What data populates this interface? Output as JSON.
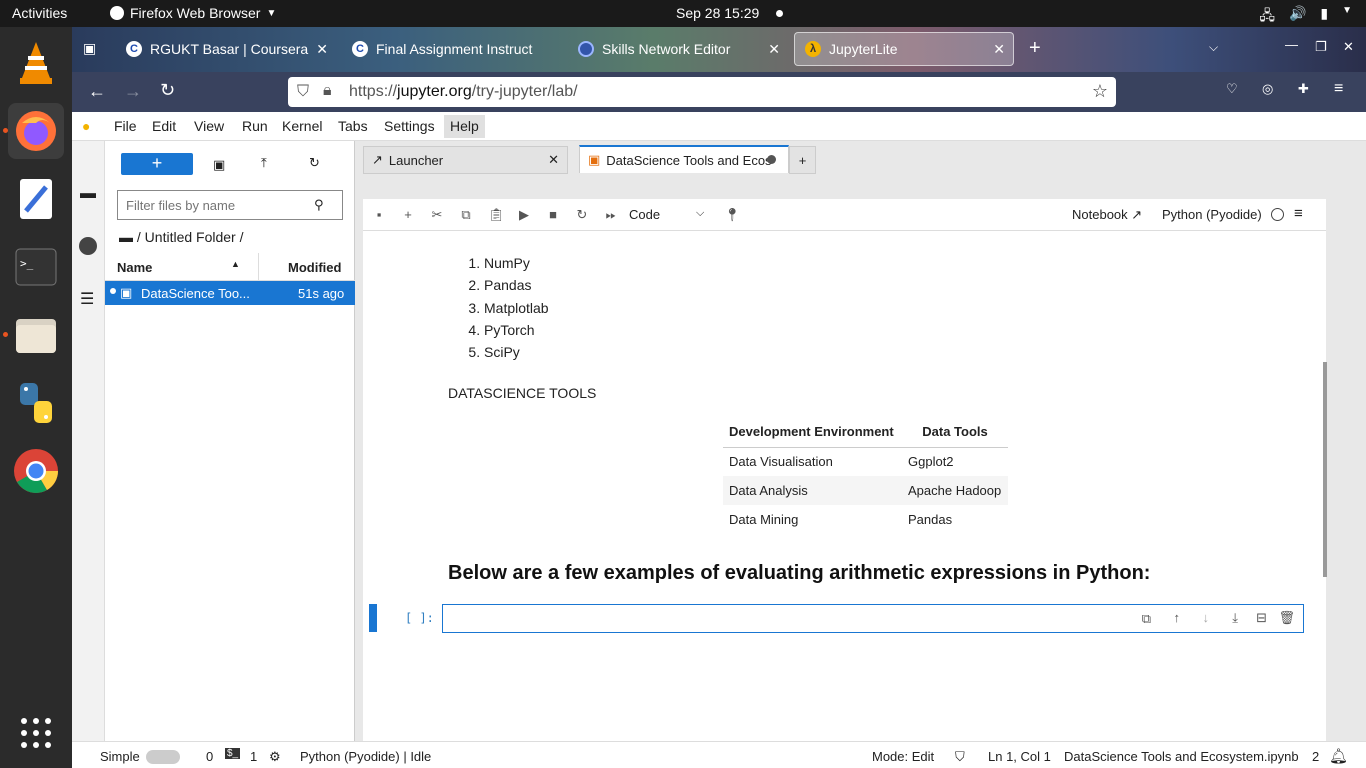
{
  "system": {
    "activities": "Activities",
    "app_name": "Firefox Web Browser",
    "clock": "Sep 28  15:29"
  },
  "browser": {
    "tabs": [
      {
        "label": "RGUKT Basar | Coursera",
        "icon": "coursera-icon"
      },
      {
        "label": "Final Assignment Instruct",
        "icon": "coursera-icon"
      },
      {
        "label": "Skills Network Editor",
        "icon": "skills-network-icon"
      },
      {
        "label": "JupyterLite",
        "icon": "jupyter-icon"
      }
    ],
    "url_prefix": "https://",
    "url_domain": "jupyter.org",
    "url_path": "/try-jupyter/lab/"
  },
  "jupyter": {
    "menu": [
      "File",
      "Edit",
      "View",
      "Run",
      "Kernel",
      "Tabs",
      "Settings",
      "Help"
    ],
    "filter_placeholder": "Filter files by name",
    "breadcrumb": "/ Untitled Folder /",
    "file_header": {
      "name": "Name",
      "modified": "Modified"
    },
    "file": {
      "name": "DataScience Too...",
      "modified": "51s ago"
    },
    "tabs": [
      {
        "label": "Launcher"
      },
      {
        "label": "DataScience Tools and Ecosy"
      }
    ],
    "cell_type": "Code",
    "notebook_link": "Notebook",
    "kernel": "Python (Pyodide)",
    "libraries": [
      "NumPy",
      "Pandas",
      "Matplotlab",
      "PyTorch",
      "SciPy"
    ],
    "section_heading": "DATASCIENCE TOOLS",
    "table": {
      "headers": [
        "Development Environment",
        "Data Tools"
      ],
      "rows": [
        [
          "Data Visualisation",
          "Ggplot2"
        ],
        [
          "Data Analysis",
          "Apache Hadoop"
        ],
        [
          "Data Mining",
          "Pandas"
        ]
      ]
    },
    "examples_heading": "Below are a few examples of evaluating arithmetic expressions in Python:",
    "cell_prompt": "[ ]:",
    "status": {
      "simple": "Simple",
      "count0": "0",
      "count1": "1",
      "kernel_status": "Python (Pyodide) | Idle",
      "mode": "Mode: Edit",
      "position": "Ln 1, Col 1",
      "filename": "DataScience Tools and Ecosystem.ipynb",
      "notifications": "2"
    }
  }
}
